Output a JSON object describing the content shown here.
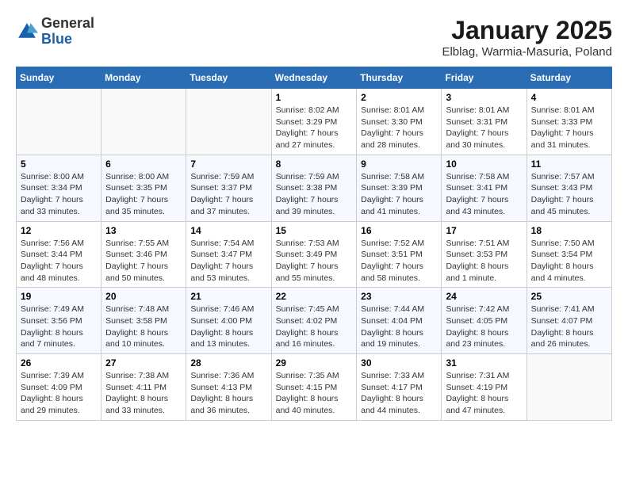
{
  "header": {
    "logo_general": "General",
    "logo_blue": "Blue",
    "title": "January 2025",
    "subtitle": "Elblag, Warmia-Masuria, Poland"
  },
  "columns": [
    "Sunday",
    "Monday",
    "Tuesday",
    "Wednesday",
    "Thursday",
    "Friday",
    "Saturday"
  ],
  "weeks": [
    [
      {
        "day": "",
        "info": ""
      },
      {
        "day": "",
        "info": ""
      },
      {
        "day": "",
        "info": ""
      },
      {
        "day": "1",
        "info": "Sunrise: 8:02 AM\nSunset: 3:29 PM\nDaylight: 7 hours and 27 minutes."
      },
      {
        "day": "2",
        "info": "Sunrise: 8:01 AM\nSunset: 3:30 PM\nDaylight: 7 hours and 28 minutes."
      },
      {
        "day": "3",
        "info": "Sunrise: 8:01 AM\nSunset: 3:31 PM\nDaylight: 7 hours and 30 minutes."
      },
      {
        "day": "4",
        "info": "Sunrise: 8:01 AM\nSunset: 3:33 PM\nDaylight: 7 hours and 31 minutes."
      }
    ],
    [
      {
        "day": "5",
        "info": "Sunrise: 8:00 AM\nSunset: 3:34 PM\nDaylight: 7 hours and 33 minutes."
      },
      {
        "day": "6",
        "info": "Sunrise: 8:00 AM\nSunset: 3:35 PM\nDaylight: 7 hours and 35 minutes."
      },
      {
        "day": "7",
        "info": "Sunrise: 7:59 AM\nSunset: 3:37 PM\nDaylight: 7 hours and 37 minutes."
      },
      {
        "day": "8",
        "info": "Sunrise: 7:59 AM\nSunset: 3:38 PM\nDaylight: 7 hours and 39 minutes."
      },
      {
        "day": "9",
        "info": "Sunrise: 7:58 AM\nSunset: 3:39 PM\nDaylight: 7 hours and 41 minutes."
      },
      {
        "day": "10",
        "info": "Sunrise: 7:58 AM\nSunset: 3:41 PM\nDaylight: 7 hours and 43 minutes."
      },
      {
        "day": "11",
        "info": "Sunrise: 7:57 AM\nSunset: 3:43 PM\nDaylight: 7 hours and 45 minutes."
      }
    ],
    [
      {
        "day": "12",
        "info": "Sunrise: 7:56 AM\nSunset: 3:44 PM\nDaylight: 7 hours and 48 minutes."
      },
      {
        "day": "13",
        "info": "Sunrise: 7:55 AM\nSunset: 3:46 PM\nDaylight: 7 hours and 50 minutes."
      },
      {
        "day": "14",
        "info": "Sunrise: 7:54 AM\nSunset: 3:47 PM\nDaylight: 7 hours and 53 minutes."
      },
      {
        "day": "15",
        "info": "Sunrise: 7:53 AM\nSunset: 3:49 PM\nDaylight: 7 hours and 55 minutes."
      },
      {
        "day": "16",
        "info": "Sunrise: 7:52 AM\nSunset: 3:51 PM\nDaylight: 7 hours and 58 minutes."
      },
      {
        "day": "17",
        "info": "Sunrise: 7:51 AM\nSunset: 3:53 PM\nDaylight: 8 hours and 1 minute."
      },
      {
        "day": "18",
        "info": "Sunrise: 7:50 AM\nSunset: 3:54 PM\nDaylight: 8 hours and 4 minutes."
      }
    ],
    [
      {
        "day": "19",
        "info": "Sunrise: 7:49 AM\nSunset: 3:56 PM\nDaylight: 8 hours and 7 minutes."
      },
      {
        "day": "20",
        "info": "Sunrise: 7:48 AM\nSunset: 3:58 PM\nDaylight: 8 hours and 10 minutes."
      },
      {
        "day": "21",
        "info": "Sunrise: 7:46 AM\nSunset: 4:00 PM\nDaylight: 8 hours and 13 minutes."
      },
      {
        "day": "22",
        "info": "Sunrise: 7:45 AM\nSunset: 4:02 PM\nDaylight: 8 hours and 16 minutes."
      },
      {
        "day": "23",
        "info": "Sunrise: 7:44 AM\nSunset: 4:04 PM\nDaylight: 8 hours and 19 minutes."
      },
      {
        "day": "24",
        "info": "Sunrise: 7:42 AM\nSunset: 4:05 PM\nDaylight: 8 hours and 23 minutes."
      },
      {
        "day": "25",
        "info": "Sunrise: 7:41 AM\nSunset: 4:07 PM\nDaylight: 8 hours and 26 minutes."
      }
    ],
    [
      {
        "day": "26",
        "info": "Sunrise: 7:39 AM\nSunset: 4:09 PM\nDaylight: 8 hours and 29 minutes."
      },
      {
        "day": "27",
        "info": "Sunrise: 7:38 AM\nSunset: 4:11 PM\nDaylight: 8 hours and 33 minutes."
      },
      {
        "day": "28",
        "info": "Sunrise: 7:36 AM\nSunset: 4:13 PM\nDaylight: 8 hours and 36 minutes."
      },
      {
        "day": "29",
        "info": "Sunrise: 7:35 AM\nSunset: 4:15 PM\nDaylight: 8 hours and 40 minutes."
      },
      {
        "day": "30",
        "info": "Sunrise: 7:33 AM\nSunset: 4:17 PM\nDaylight: 8 hours and 44 minutes."
      },
      {
        "day": "31",
        "info": "Sunrise: 7:31 AM\nSunset: 4:19 PM\nDaylight: 8 hours and 47 minutes."
      },
      {
        "day": "",
        "info": ""
      }
    ]
  ]
}
